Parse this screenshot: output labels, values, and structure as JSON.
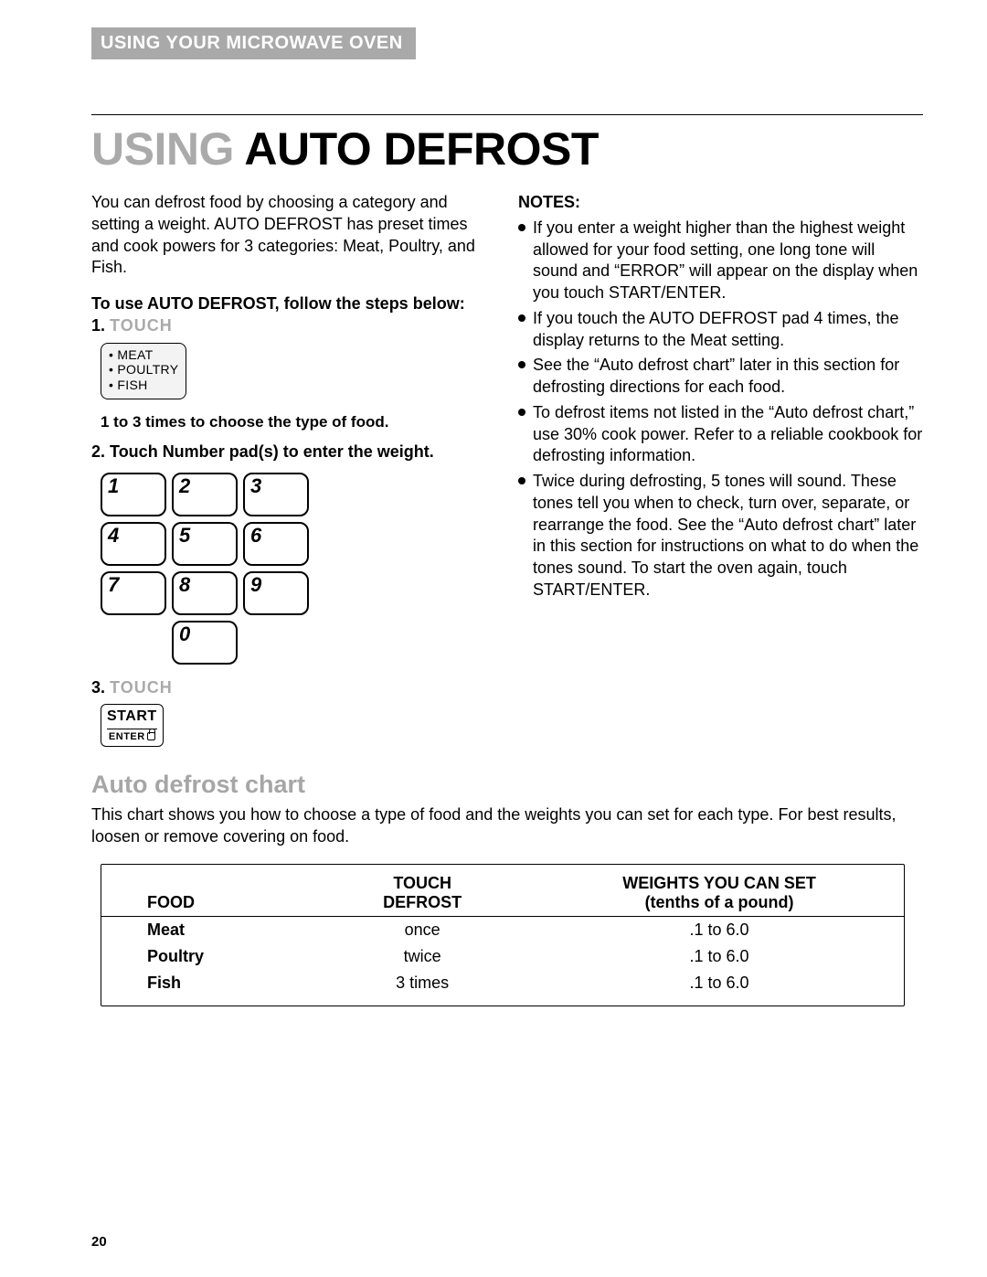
{
  "header": {
    "bar": "USING YOUR MICROWAVE OVEN"
  },
  "title": {
    "t1": "USING",
    "t2": "AUTO DEFROST"
  },
  "intro": "You can defrost food by choosing a category and setting a weight. AUTO DEFROST has preset times and cook powers for 3 categories: Meat, Poultry, and Fish.",
  "steps_heading": "To use AUTO DEFROST, follow the steps below:",
  "step1": {
    "num": "1.",
    "label": "TOUCH"
  },
  "defrost_button": {
    "items": [
      "MEAT",
      "POULTRY",
      "FISH"
    ]
  },
  "step1_sub": "1 to 3 times to choose the type of food.",
  "step2": {
    "num": "2.",
    "label": "Touch Number pad(s) to enter the weight."
  },
  "keypad": [
    "1",
    "2",
    "3",
    "4",
    "5",
    "6",
    "7",
    "8",
    "9",
    "0"
  ],
  "step3": {
    "num": "3.",
    "label": "TOUCH"
  },
  "start_button": {
    "top": "START",
    "bottom": "ENTER"
  },
  "notes": {
    "heading": "NOTES:",
    "items": [
      "If you enter a weight higher than the highest weight allowed for your food setting, one long tone will sound and “ERROR” will appear on the display when you touch START/ENTER.",
      "If you touch the AUTO DEFROST pad 4 times, the display returns to the Meat setting.",
      "See the “Auto defrost chart” later in this section for defrosting directions for each food.",
      "To defrost items not listed in the “Auto defrost chart,” use 30% cook power. Refer to a reliable cookbook for defrosting information.",
      "Twice during defrosting, 5 tones will sound. These tones tell you when to check, turn over, separate, or rearrange the food. See the “Auto defrost chart” later in this section for instructions on what to do when the tones sound. To start the oven again, touch START/ENTER."
    ]
  },
  "chart": {
    "title": "Auto defrost chart",
    "intro": "This chart shows you how to choose a type of food and the weights you can set for each type. For best results, loosen or remove covering on food.",
    "head": {
      "c1": "FOOD",
      "c2a": "TOUCH",
      "c2b": "DEFROST",
      "c3a": "WEIGHTS YOU CAN SET",
      "c3b": "(tenths of a pound)"
    },
    "rows": [
      {
        "food": "Meat",
        "touch": "once",
        "weight": ".1 to 6.0"
      },
      {
        "food": "Poultry",
        "touch": "twice",
        "weight": ".1 to 6.0"
      },
      {
        "food": "Fish",
        "touch": "3 times",
        "weight": ".1 to 6.0"
      }
    ]
  },
  "page_number": "20"
}
